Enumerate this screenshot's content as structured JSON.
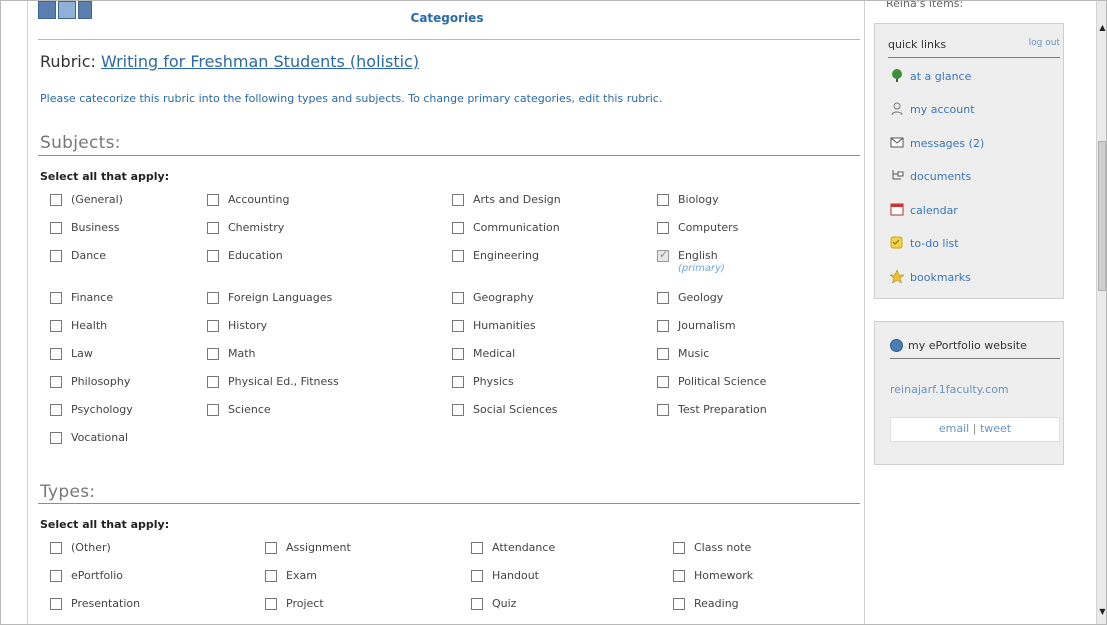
{
  "header": {
    "title": "Categories"
  },
  "rubric": {
    "prefix": "Rubric:",
    "name": "Writing for Freshman Students (holistic)",
    "instructions": "Please catecorize this rubric into the following types and subjects. To change primary categories, edit this rubric."
  },
  "subjects": {
    "heading": "Subjects:",
    "select_all": "Select all that apply:",
    "rows": [
      [
        {
          "label": "(General)",
          "checked": false
        },
        {
          "label": "Accounting",
          "checked": false
        },
        {
          "label": "Arts and Design",
          "checked": false
        },
        {
          "label": "Biology",
          "checked": false
        }
      ],
      [
        {
          "label": "Business",
          "checked": false
        },
        {
          "label": "Chemistry",
          "checked": false
        },
        {
          "label": "Communication",
          "checked": false
        },
        {
          "label": "Computers",
          "checked": false
        }
      ],
      [
        {
          "label": "Dance",
          "checked": false
        },
        {
          "label": "Education",
          "checked": false
        },
        {
          "label": "Engineering",
          "checked": false
        },
        {
          "label": "English",
          "checked": true,
          "note": "(primary)"
        }
      ],
      [
        {
          "label": "Finance",
          "checked": false
        },
        {
          "label": "Foreign Languages",
          "checked": false
        },
        {
          "label": "Geography",
          "checked": false
        },
        {
          "label": "Geology",
          "checked": false
        }
      ],
      [
        {
          "label": "Health",
          "checked": false
        },
        {
          "label": "History",
          "checked": false
        },
        {
          "label": "Humanities",
          "checked": false
        },
        {
          "label": "Journalism",
          "checked": false
        }
      ],
      [
        {
          "label": "Law",
          "checked": false
        },
        {
          "label": "Math",
          "checked": false
        },
        {
          "label": "Medical",
          "checked": false
        },
        {
          "label": "Music",
          "checked": false
        }
      ],
      [
        {
          "label": "Philosophy",
          "checked": false
        },
        {
          "label": "Physical Ed., Fitness",
          "checked": false
        },
        {
          "label": "Physics",
          "checked": false
        },
        {
          "label": "Political Science",
          "checked": false
        }
      ],
      [
        {
          "label": "Psychology",
          "checked": false
        },
        {
          "label": "Science",
          "checked": false
        },
        {
          "label": "Social Sciences",
          "checked": false
        },
        {
          "label": "Test Preparation",
          "checked": false
        }
      ],
      [
        {
          "label": "Vocational",
          "checked": false
        }
      ]
    ]
  },
  "types": {
    "heading": "Types:",
    "select_all": "Select all that apply:",
    "rows": [
      [
        {
          "label": "(Other)",
          "checked": false
        },
        {
          "label": "Assignment",
          "checked": false
        },
        {
          "label": "Attendance",
          "checked": false
        },
        {
          "label": "Class note",
          "checked": false
        }
      ],
      [
        {
          "label": "ePortfolio",
          "checked": false
        },
        {
          "label": "Exam",
          "checked": false
        },
        {
          "label": "Handout",
          "checked": false
        },
        {
          "label": "Homework",
          "checked": false
        }
      ],
      [
        {
          "label": "Presentation",
          "checked": false
        },
        {
          "label": "Project",
          "checked": false
        },
        {
          "label": "Quiz",
          "checked": false
        },
        {
          "label": "Reading",
          "checked": false
        }
      ]
    ]
  },
  "sidebar": {
    "title": "Reina's items:",
    "quick_links": {
      "title": "quick links",
      "logout": "log out",
      "items": [
        {
          "label": "at a glance",
          "icon": "tree-icon"
        },
        {
          "label": "my account",
          "icon": "user-icon"
        },
        {
          "label": "messages (2)",
          "icon": "envelope-icon"
        },
        {
          "label": "documents",
          "icon": "folder-tree-icon"
        },
        {
          "label": "calendar",
          "icon": "calendar-icon"
        },
        {
          "label": "to-do list",
          "icon": "checklist-icon"
        },
        {
          "label": "bookmarks",
          "icon": "star-icon"
        }
      ]
    },
    "eportfolio": {
      "title": "my ePortfolio website",
      "url": "reinajarf.1faculty.com",
      "email": "email",
      "separator": "|",
      "tweet": "tweet"
    }
  }
}
